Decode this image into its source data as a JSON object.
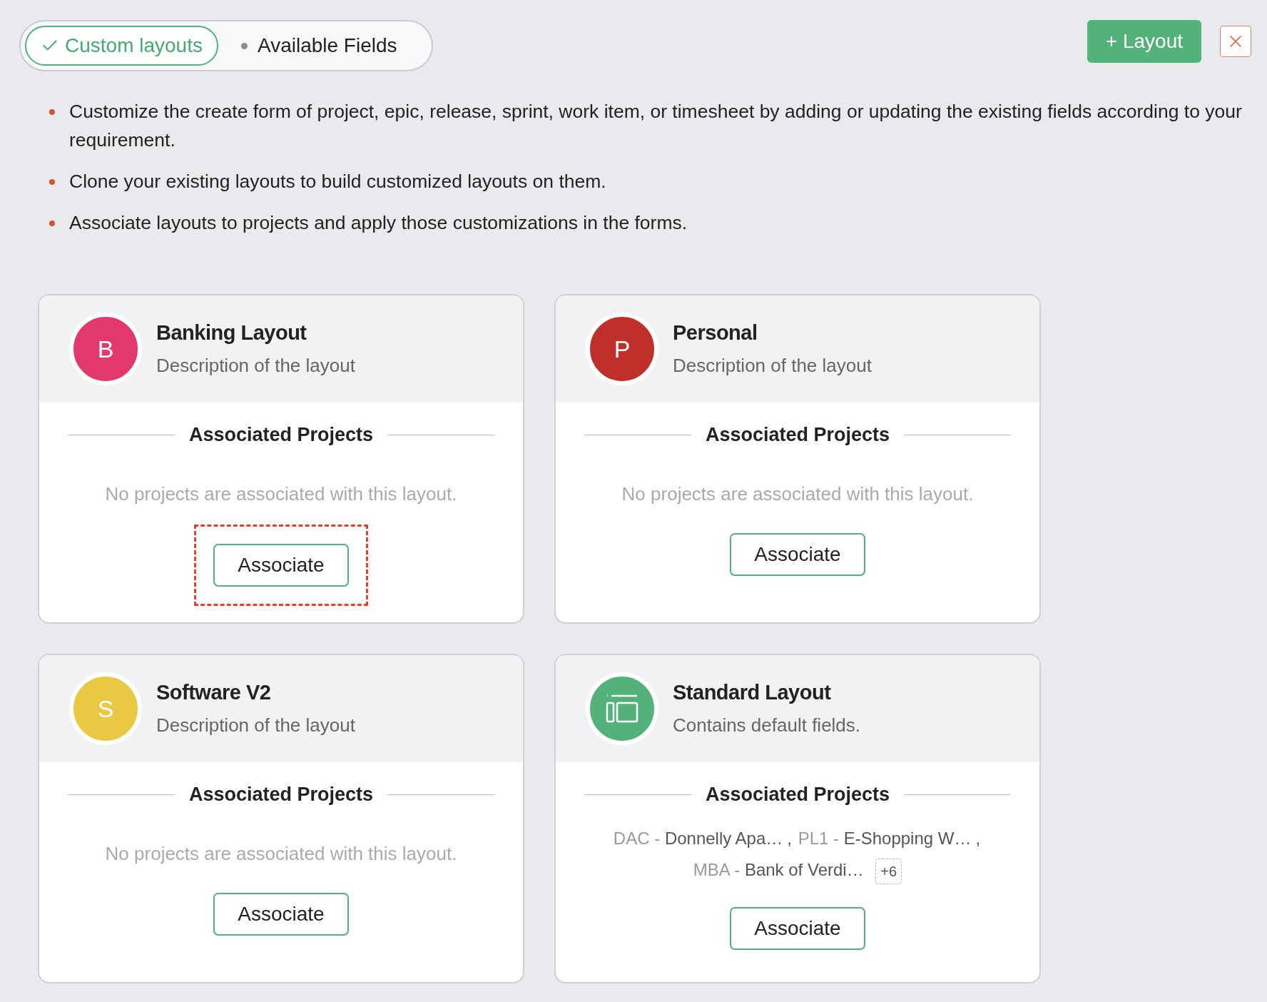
{
  "tabs": [
    {
      "label": "Custom layouts",
      "selected": true
    },
    {
      "label": "Available Fields",
      "selected": false
    }
  ],
  "add_button": "+ Layout",
  "notes": [
    "Customize the create form of project, epic, release, sprint, work item, or timesheet by adding or updating the existing fields according to your requirement.",
    "Clone your existing layouts to build customized layouts on them.",
    "Associate layouts to projects and apply those customizations in the forms."
  ],
  "layouts": [
    {
      "title": "Banking Layout",
      "description": "Description of the layout",
      "avatar": {
        "kind": "letter",
        "letter": "B",
        "color": "#e3386b"
      },
      "section_title": "Associated Projects",
      "empty_text": "No projects are associated with this layout.",
      "button": "Associate",
      "highlighted": true
    },
    {
      "title": "Personal",
      "description": "Description of the layout",
      "avatar": {
        "kind": "letter",
        "letter": "P",
        "color": "#c0302b"
      },
      "section_title": "Associated Projects",
      "empty_text": "No projects are associated with this layout.",
      "button": "Associate",
      "highlighted": false
    },
    {
      "title": "Software V2",
      "description": "Description of the layout",
      "avatar": {
        "kind": "letter",
        "letter": "S",
        "color": "#e8c941"
      },
      "section_title": "Associated Projects",
      "empty_text": "No projects are associated with this layout.",
      "button": "Associate",
      "highlighted": false
    },
    {
      "title": "Standard Layout",
      "description": "Contains default fields.",
      "avatar": {
        "kind": "icon",
        "color": "#52b27a"
      },
      "section_title": "Associated Projects",
      "projects": [
        {
          "code": "DAC",
          "dash": "-",
          "name": "Donnelly Apa…",
          "separator": ","
        },
        {
          "code": "PL1",
          "dash": "-",
          "name": "E-Shopping W…",
          "separator": ","
        },
        {
          "code": "MBA",
          "dash": "-",
          "name": "Bank of Verdi…"
        }
      ],
      "more": "+6",
      "button": "Associate",
      "highlighted": false
    }
  ]
}
